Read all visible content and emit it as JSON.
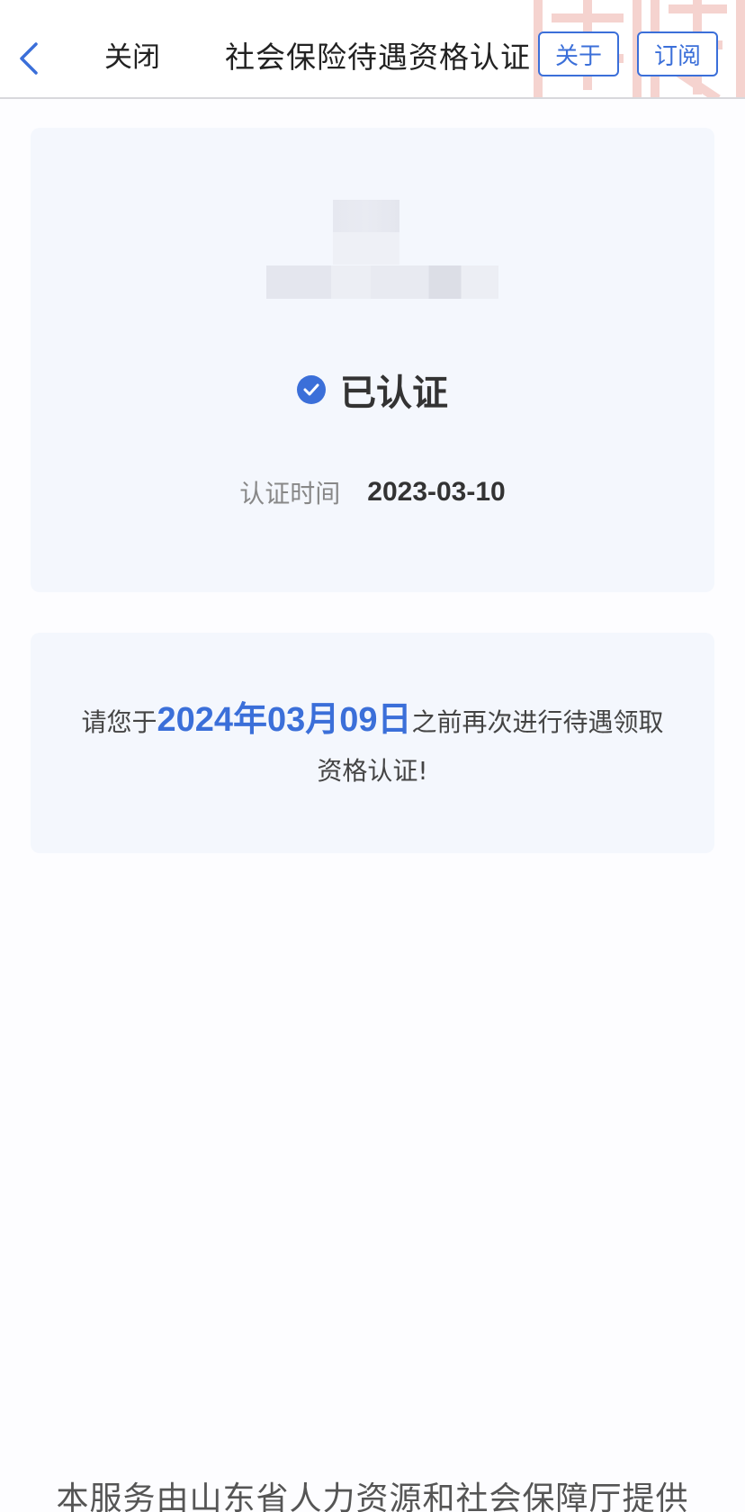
{
  "header": {
    "close_label": "关闭",
    "title": "社会保险待遇资格认证",
    "about_label": "关于",
    "subscribe_label": "订阅"
  },
  "status": {
    "verified_label": "已认证",
    "cert_time_label": "认证时间",
    "cert_date": "2023-03-10"
  },
  "notice": {
    "prefix": "请您于",
    "deadline": "2024年03月09日",
    "suffix": "之前再次进行待遇领取资格认证!"
  },
  "footer": {
    "text": "本服务由山东省人力资源和社会保障厅提供"
  },
  "colors": {
    "accent": "#3b6fd9",
    "card_bg": "#f4f7fd"
  },
  "icons": {
    "back": "chevron-left-icon",
    "verified": "check-circle-icon"
  }
}
